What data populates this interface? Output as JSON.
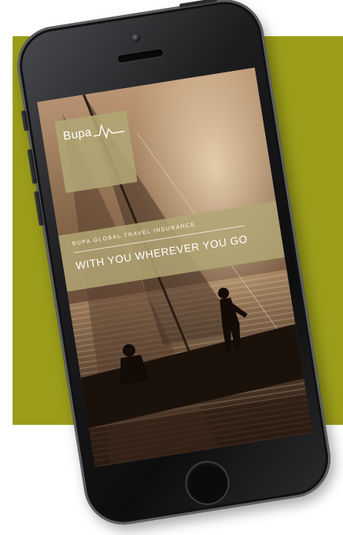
{
  "brand": {
    "logo_text": "Bupa"
  },
  "screen": {
    "tagline_small": "BUPA GLOBAL TRAVEL INSURANCE",
    "tagline_main": "WITH YOU WHEREVER YOU GO"
  },
  "colors": {
    "background_block": "#9a9c1a",
    "overlay_box": "#b2a674",
    "phone_body": "#1d1d1f"
  },
  "icons": {
    "logo_mark": "heartbeat-line-icon",
    "home": "home-button-icon"
  }
}
